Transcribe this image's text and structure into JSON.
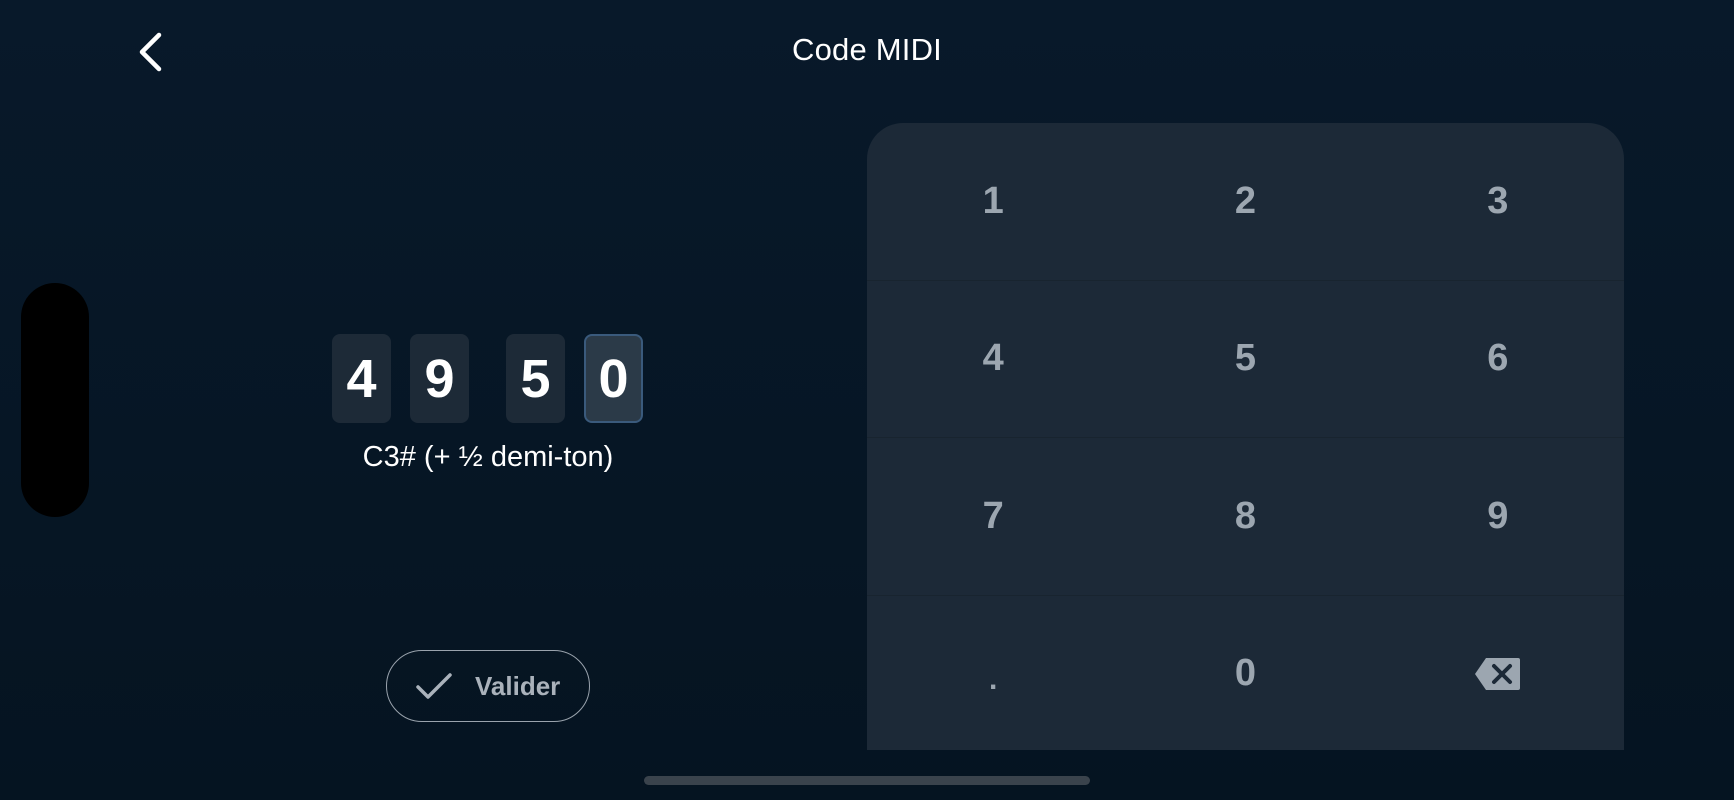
{
  "header": {
    "title": "Code MIDI"
  },
  "midi_code": {
    "digits": [
      "4",
      "9",
      "5",
      "0"
    ],
    "note_label": "C3# (+ ½ demi-ton)"
  },
  "actions": {
    "validate_label": "Valider"
  },
  "keypad": {
    "rows": [
      [
        "1",
        "2",
        "3"
      ],
      [
        "4",
        "5",
        "6"
      ],
      [
        "7",
        "8",
        "9"
      ],
      [
        ".",
        "0",
        "backspace"
      ]
    ]
  },
  "colors": {
    "background": "#071726",
    "keypad_background": "#1c2937",
    "digit_box": "#1d2a37",
    "active_digit_border": "#3a5a7c",
    "key_text": "#9ca6b0"
  }
}
